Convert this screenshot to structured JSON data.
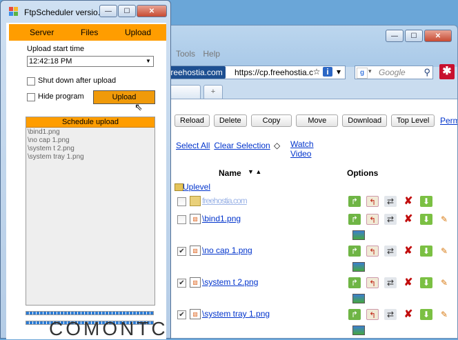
{
  "browser": {
    "menu": [
      "Tools",
      "Help"
    ],
    "site_badge": "freehostia.com",
    "url": "https://cp.freehostia.c",
    "search_placeholder": "Google",
    "new_tab_symbol": "+",
    "buttons": [
      "Reload",
      "Delete",
      "Copy",
      "Move",
      "Download",
      "Top Level"
    ],
    "perm_link": "Perm",
    "select_all": "Select All",
    "clear_selection": "Clear Selection",
    "watch_video": "Watch Video",
    "header_name": "Name",
    "header_sort": "▼ ▲",
    "header_options": "Options",
    "uplevel": "Uplevel",
    "files": [
      {
        "name": "freehostia.com",
        "checked": false,
        "type": "folder"
      },
      {
        "name": "\\bind1.png",
        "checked": false,
        "type": "file"
      },
      {
        "name": "\\no cap 1.png",
        "checked": true,
        "type": "file"
      },
      {
        "name": "\\system t 2.png",
        "checked": true,
        "type": "file"
      },
      {
        "name": "\\system tray 1.png",
        "checked": true,
        "type": "file"
      }
    ],
    "option_icons": [
      "upload-icon",
      "rename-icon",
      "move-icon",
      "delete-icon",
      "download-icon",
      "edit-icon"
    ]
  },
  "app": {
    "title": "FtpScheduler versio...",
    "tabs": [
      "Server",
      "Files",
      "Upload"
    ],
    "start_label": "Upload start time",
    "time": "12:42:18 PM",
    "shutdown_label": "Shut down after upload",
    "hide_label": "Hide program",
    "upload_button": "Upload",
    "schedule_header": "Schedule upload",
    "schedule_files": [
      "\\bind1.png",
      "\\no cap 1.png",
      "\\system t 2.png",
      "\\system tray 1.png"
    ],
    "brand": "COMONTC"
  },
  "colors": {
    "accent_orange": "#ff9d00",
    "link_blue": "#0033cc",
    "progress_blue": "#2b7bd4"
  }
}
